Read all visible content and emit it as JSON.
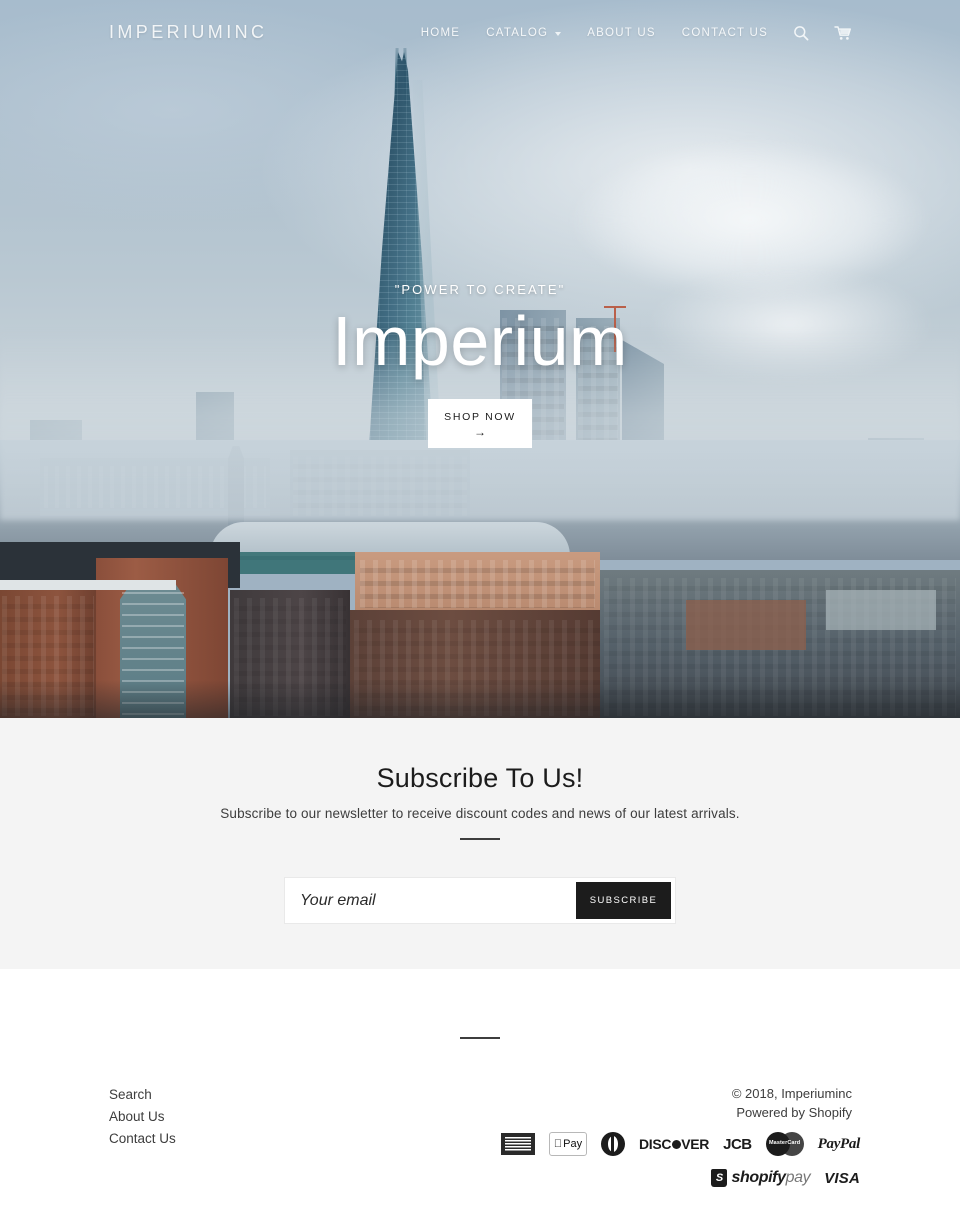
{
  "header": {
    "logo": "IMPERIUMINC",
    "nav": [
      {
        "label": "HOME",
        "has_dropdown": false
      },
      {
        "label": "CATALOG",
        "has_dropdown": true
      },
      {
        "label": "ABOUT US",
        "has_dropdown": false
      },
      {
        "label": "CONTACT US",
        "has_dropdown": false
      }
    ],
    "search_icon": "search-icon",
    "cart_icon": "cart-icon"
  },
  "hero": {
    "subtitle": "\"POWER TO CREATE\"",
    "title": "Imperium",
    "button_label": "SHOP NOW",
    "button_arrow": "→",
    "image_description": "London skyline with The Shard"
  },
  "newsletter": {
    "title": "Subscribe To Us!",
    "description": "Subscribe to our newsletter to receive discount codes and news of our latest arrivals.",
    "email_placeholder": "Your email",
    "email_value": "",
    "submit_label": "SUBSCRIBE"
  },
  "footer": {
    "links": [
      {
        "label": "Search"
      },
      {
        "label": "About Us"
      },
      {
        "label": "Contact Us"
      }
    ],
    "copyright": "© 2018, Imperiuminc",
    "powered_by": "Powered by Shopify",
    "payment_methods": [
      {
        "name": "american-express",
        "label": "AMERICAN EXPRESS"
      },
      {
        "name": "apple-pay",
        "label": "Pay"
      },
      {
        "name": "diners-club",
        "label": "Diners Club"
      },
      {
        "name": "discover",
        "label": "DISC VER"
      },
      {
        "name": "jcb",
        "label": "JCB"
      },
      {
        "name": "mastercard",
        "label": "MasterCard"
      },
      {
        "name": "paypal",
        "label": "PayPal"
      },
      {
        "name": "shopify-pay",
        "label": "shopify pay"
      },
      {
        "name": "visa",
        "label": "VISA"
      }
    ],
    "discover_a": "DISC",
    "discover_b": "VER",
    "shopify_a": "shopify",
    "shopify_b": "pay"
  },
  "colors": {
    "accent_dark": "#1c1c1c",
    "newsletter_bg": "#f4f4f4",
    "page_bg": "#ffffff",
    "hero_text": "#ffffff",
    "sky": "#aebecb"
  }
}
